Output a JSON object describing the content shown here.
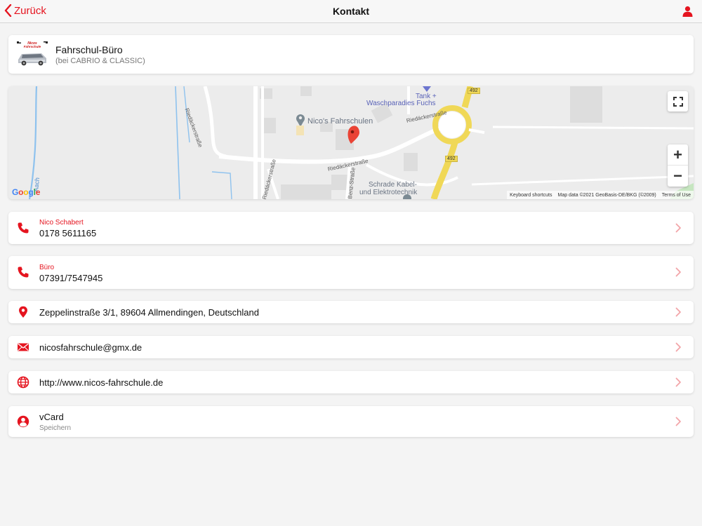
{
  "nav": {
    "back_label": "Zurück",
    "title": "Kontakt"
  },
  "colors": {
    "accent": "#e5141f"
  },
  "icons": {
    "back": "chevron-left-icon",
    "user": "user-icon",
    "phone": "phone-icon",
    "location": "map-pin-icon",
    "mail": "envelope-icon",
    "web": "globe-icon",
    "vcard": "person-circle-icon",
    "chevron": "chevron-right-icon"
  },
  "header": {
    "title": "Fahrschul-Büro",
    "subtitle": "(bei CABRIO & CLASSIC)",
    "logo_text": "Nicos Fahrschule"
  },
  "map": {
    "pin_label": "Nico's Fahrschulen",
    "labels": {
      "street_1": "Riedäckerstraße",
      "street_2": "Riedäckerstraße",
      "street_3": "Riedäckerstraße",
      "street_4": "Riedäckerstraße",
      "street_5": "Benz-Straße",
      "poi_1": "Tank +",
      "poi_2": "Waschparadies Fuchs",
      "poi_3": "Schrade Kabel-",
      "poi_4": "und Elektrotechnik",
      "road_1": "492",
      "road_2": "492",
      "water": "Aach"
    },
    "footer": {
      "shortcuts": "Keyboard shortcuts",
      "attribution": "Map data ©2021 GeoBasis-DE/BKG (©2009)",
      "terms": "Terms of Use"
    },
    "google": "Google",
    "zoom_in": "+",
    "zoom_out": "−"
  },
  "rows": {
    "phone1": {
      "label": "Nico Schabert",
      "value": "0178 5611165"
    },
    "phone2": {
      "label": "Büro",
      "value": "07391/7547945"
    },
    "address": {
      "value": "Zeppelinstraße 3/1, 89604 Allmendingen, Deutschland"
    },
    "email": {
      "value": "nicosfahrschule@gmx.de"
    },
    "web": {
      "value": "http://www.nicos-fahrschule.de"
    },
    "vcard": {
      "value": "vCard",
      "sub": "Speichern"
    }
  }
}
